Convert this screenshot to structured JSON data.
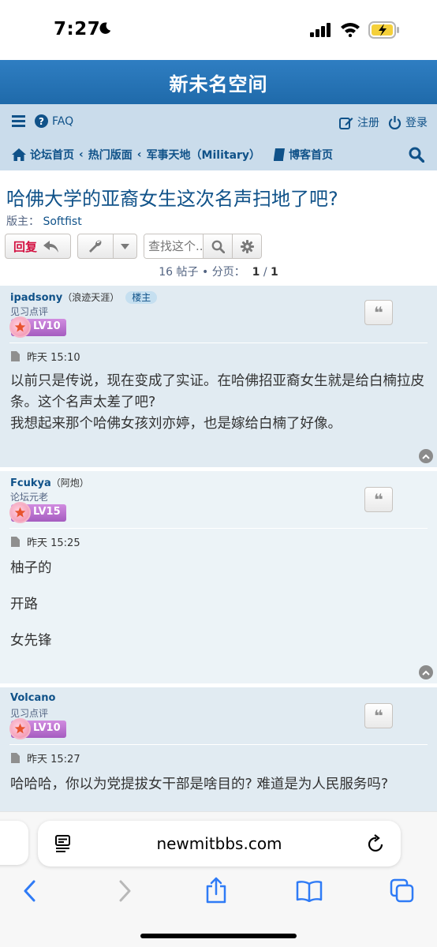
{
  "status_bar": {
    "time": "7:27"
  },
  "site": {
    "title": "新未名空间"
  },
  "nav": {
    "faq": "FAQ",
    "register": "注册",
    "login": "登录",
    "breadcrumbs": [
      "论坛首页",
      "热门版面",
      "军事天地（Military）"
    ],
    "blog": "博客首页"
  },
  "topic": {
    "title": "哈佛大学的亚裔女生这次名声扫地了吧?",
    "moderator_label": "版主：",
    "moderator": "Softfist",
    "reply_label": "回复",
    "search_placeholder": "查找这个...",
    "pagination": {
      "count_text": "16 帖子 • 分页：",
      "current": "1",
      "sep": "/",
      "total": "1"
    }
  },
  "posts": [
    {
      "author": "ipadsony",
      "alias": "（浪迹天涯）",
      "badge": "楼主",
      "rank": "见习点评",
      "level": "LV10",
      "date": "昨天 15:10",
      "body": [
        "以前只是传说，现在变成了实证。在哈佛招亚裔女生就是给白楠拉皮条。这个名声太差了吧?",
        "我想起来那个哈佛女孩刘亦婷，也是嫁给白楠了好像。"
      ]
    },
    {
      "author": "Fcukya",
      "alias": "（阿炮）",
      "rank": "论坛元老",
      "level": "LV15",
      "date": "昨天 15:25",
      "body": [
        "柚子的",
        "开路",
        "女先锋"
      ]
    },
    {
      "author": "Volcano",
      "rank": "见习点评",
      "level": "LV10",
      "date": "昨天 15:27",
      "body": [
        "哈哈哈，你以为党提拔女干部是啥目的? 难道是为人民服务吗?"
      ]
    }
  ],
  "browser": {
    "url": "newmitbbs.com"
  },
  "icons": [
    "menu-icon",
    "help-icon",
    "edit-icon",
    "power-icon",
    "home-icon",
    "book-icon",
    "search-icon",
    "wrench-icon",
    "gear-icon",
    "quote-icon",
    "page-icon",
    "scroll-top-icon",
    "back-icon",
    "forward-icon",
    "share-icon",
    "bookmarks-icon",
    "tabs-icon",
    "reload-icon",
    "reader-icon"
  ],
  "colors": {
    "header": "#2a77bb",
    "nav": "#cadceb",
    "link": "#105289",
    "reply": "#d31141",
    "post_a": "#e1ebf2",
    "post_b": "#ecf3f7"
  }
}
